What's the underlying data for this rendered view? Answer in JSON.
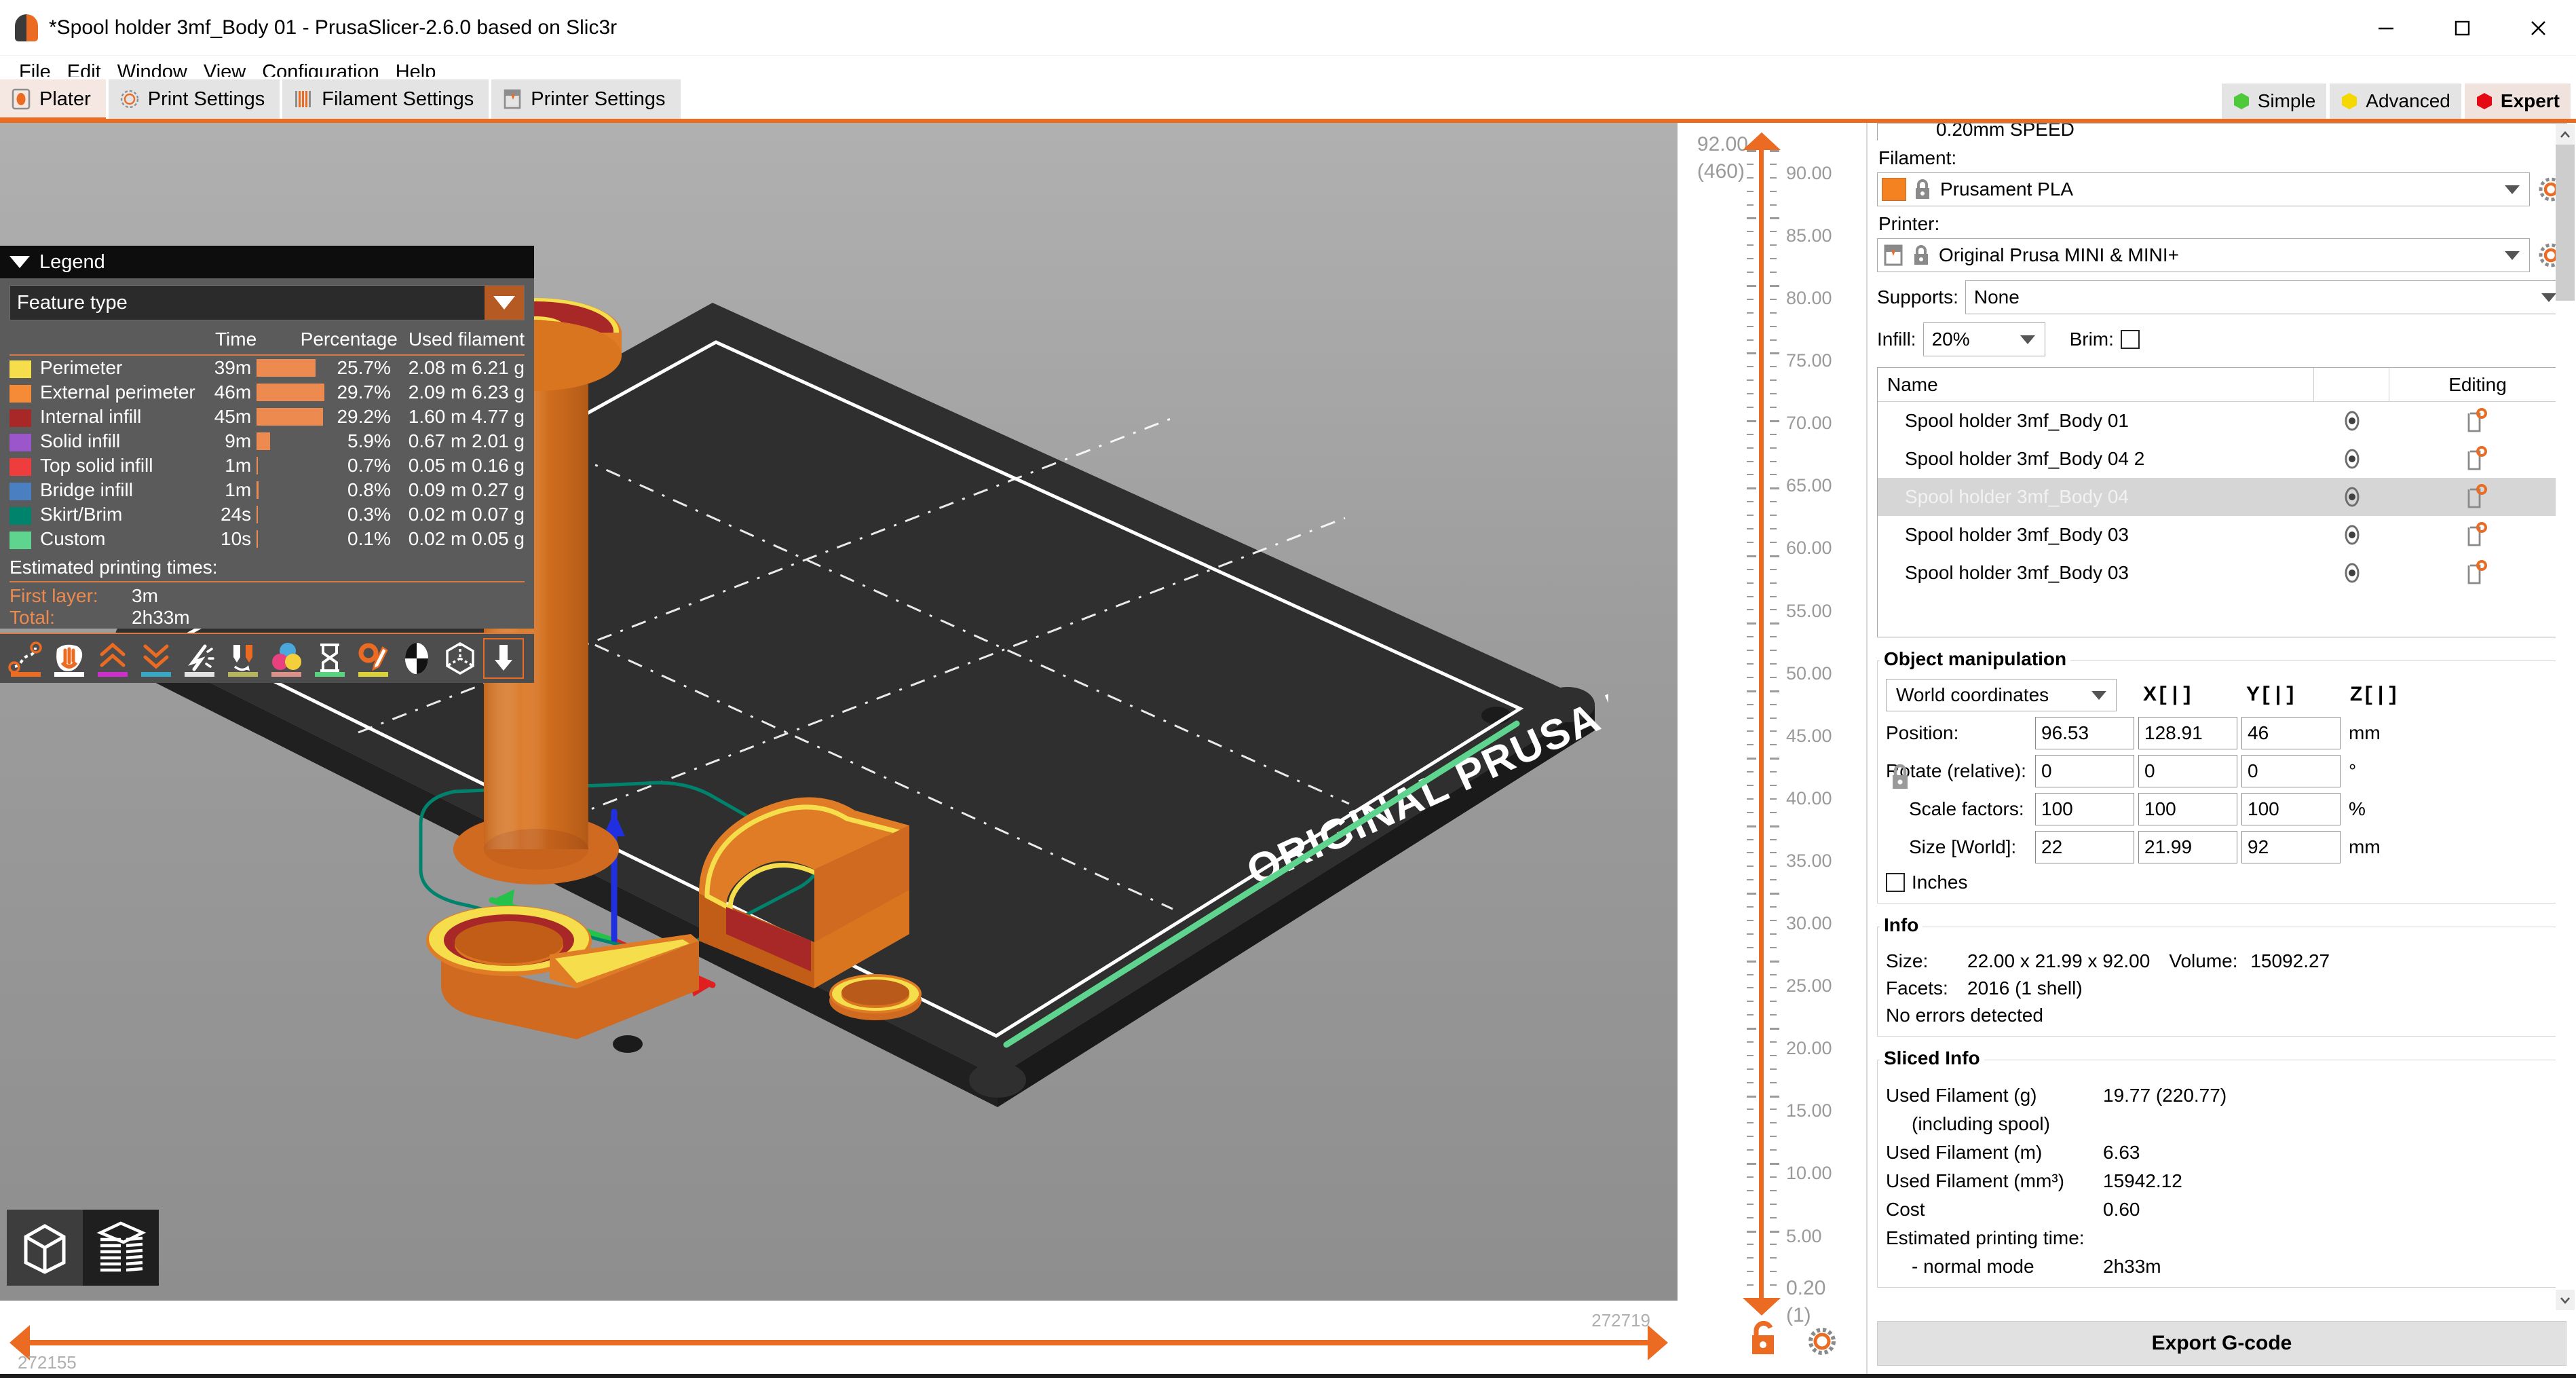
{
  "window": {
    "title": "*Spool holder 3mf_Body 01 - PrusaSlicer-2.6.0 based on Slic3r",
    "minimize": "minimize-icon",
    "maximize": "maximize-icon",
    "close": "close-icon"
  },
  "menu": {
    "items": [
      "File",
      "Edit",
      "Window",
      "View",
      "Configuration",
      "Help"
    ]
  },
  "tabs": [
    {
      "label": "Plater",
      "icon": "plater-icon",
      "active": true
    },
    {
      "label": "Print Settings",
      "icon": "print-settings-icon",
      "active": false
    },
    {
      "label": "Filament Settings",
      "icon": "filament-settings-icon",
      "active": false
    },
    {
      "label": "Printer Settings",
      "icon": "printer-settings-icon",
      "active": false
    }
  ],
  "modes": [
    {
      "label": "Simple",
      "color": "#4ec93a",
      "active": false
    },
    {
      "label": "Advanced",
      "color": "#f5d800",
      "active": false
    },
    {
      "label": "Expert",
      "color": "#e50914",
      "active": true
    }
  ],
  "legend": {
    "title": "Legend",
    "view_type": "Feature type",
    "columns": [
      "",
      "Time",
      "Percentage",
      "Used filament"
    ],
    "rows": [
      {
        "color": "#f5dd4b",
        "name": "Perimeter",
        "time": "39m",
        "pct": "25.7%",
        "pct_num": 25.7,
        "used": "2.08 m 6.21 g"
      },
      {
        "color": "#f68b37",
        "name": "External perimeter",
        "time": "46m",
        "pct": "29.7%",
        "pct_num": 29.7,
        "used": "2.09 m 6.23 g"
      },
      {
        "color": "#a82827",
        "name": "Internal infill",
        "time": "45m",
        "pct": "29.2%",
        "pct_num": 29.2,
        "used": "1.60 m 4.77 g"
      },
      {
        "color": "#9b56cc",
        "name": "Solid infill",
        "time": "9m",
        "pct": "5.9%",
        "pct_num": 5.9,
        "used": "0.67 m 2.01 g"
      },
      {
        "color": "#ee3d3d",
        "name": "Top solid infill",
        "time": "1m",
        "pct": "0.7%",
        "pct_num": 0.7,
        "used": "0.05 m 0.16 g"
      },
      {
        "color": "#4a7fc1",
        "name": "Bridge infill",
        "time": "1m",
        "pct": "0.8%",
        "pct_num": 0.8,
        "used": "0.09 m 0.27 g"
      },
      {
        "color": "#00836d",
        "name": "Skirt/Brim",
        "time": "24s",
        "pct": "0.3%",
        "pct_num": 0.3,
        "used": "0.02 m 0.07 g"
      },
      {
        "color": "#5fd48e",
        "name": "Custom",
        "time": "10s",
        "pct": "0.1%",
        "pct_num": 0.1,
        "used": "0.02 m 0.05 g"
      }
    ],
    "estimated_title": "Estimated printing times:",
    "first_layer_label": "First layer:",
    "first_layer_value": "3m",
    "total_label": "Total:",
    "total_value": "2h33m",
    "toolbar_icons": [
      {
        "name": "travel-paths-icon",
        "bar": "#ec6b23",
        "boxed": false
      },
      {
        "name": "wipe-icon",
        "bar": "#ffffff",
        "boxed": false
      },
      {
        "name": "retractions-icon",
        "bar": "#cc2fcc",
        "boxed": false
      },
      {
        "name": "deretractions-icon",
        "bar": "#34a8c4",
        "boxed": false
      },
      {
        "name": "seams-icon",
        "bar": "#e3e3e3",
        "boxed": false
      },
      {
        "name": "tool-changes-icon",
        "bar": "#b5b45a",
        "boxed": false
      },
      {
        "name": "color-changes-icon",
        "bar": "#d99189",
        "boxed": false
      },
      {
        "name": "pause-prints-icon",
        "bar": "#58d47e",
        "boxed": false
      },
      {
        "name": "custom-gcodes-icon",
        "bar": "#dbd23a",
        "boxed": false
      },
      {
        "name": "center-of-mass-icon",
        "bar": "",
        "boxed": false
      },
      {
        "name": "shells-icon",
        "bar": "",
        "boxed": false
      },
      {
        "name": "tool-marker-icon",
        "bar": "",
        "boxed": true
      }
    ]
  },
  "view_toggles": [
    {
      "name": "editor-view-icon",
      "label": "3D editor view"
    },
    {
      "name": "preview-view-icon",
      "label": "Preview"
    }
  ],
  "bed": {
    "brand_text": "ORIGINAL PRUSA MINI"
  },
  "horizontal_slider": {
    "right_value": "272719",
    "left_value": "272155"
  },
  "vertical_slider": {
    "top_value": "92.00",
    "top_layer": "(460)",
    "bottom_value": "0.20",
    "bottom_layer": "(1)",
    "ticks": [
      "90.00",
      "85.00",
      "80.00",
      "75.00",
      "70.00",
      "65.00",
      "60.00",
      "55.00",
      "50.00",
      "45.00",
      "40.00",
      "35.00",
      "30.00",
      "25.00",
      "20.00",
      "15.00",
      "10.00",
      "5.00"
    ],
    "lock_icon": "unlocked-icon",
    "gear_icon": "gear-icon"
  },
  "sidebar": {
    "print_preset_clipped": "0.20mm SPEED",
    "filament_label": "Filament:",
    "filament_value": "Prusament PLA",
    "filament_color": "#f58220",
    "printer_label": "Printer:",
    "printer_value": "Original Prusa MINI & MINI+",
    "supports_label": "Supports:",
    "supports_value": "None",
    "infill_label": "Infill:",
    "infill_value": "20%",
    "brim_label": "Brim:",
    "brim_checked": false,
    "objlist": {
      "col_name": "Name",
      "col_editing": "Editing",
      "rows": [
        {
          "name": "Spool holder 3mf_Body 01",
          "selected": false
        },
        {
          "name": "Spool holder 3mf_Body 04 2",
          "selected": false
        },
        {
          "name": "Spool holder 3mf_Body 04",
          "selected": true
        },
        {
          "name": "Spool holder 3mf_Body 03",
          "selected": false
        },
        {
          "name": "Spool holder 3mf_Body 03",
          "selected": false
        }
      ]
    },
    "manipulation": {
      "title": "Object manipulation",
      "coordinates": "World coordinates",
      "axes": [
        "X",
        "Y",
        "Z"
      ],
      "rows": [
        {
          "label": "Position:",
          "x": "96.53",
          "y": "128.91",
          "z": "46",
          "unit": "mm",
          "indent": false
        },
        {
          "label": "Rotate (relative):",
          "x": "0",
          "y": "0",
          "z": "0",
          "unit": "°",
          "indent": false
        },
        {
          "label": "Scale factors:",
          "x": "100",
          "y": "100",
          "z": "100",
          "unit": "%",
          "indent": true
        },
        {
          "label": "Size [World]:",
          "x": "22",
          "y": "21.99",
          "z": "92",
          "unit": "mm",
          "indent": true
        }
      ],
      "inches_label": "Inches",
      "inches_checked": false,
      "lock_icon": "uniform-scale-lock-icon"
    },
    "info": {
      "title": "Info",
      "size_key": "Size:",
      "size_value": "22.00 x 21.99 x 92.00",
      "volume_key": "Volume:",
      "volume_value": "15092.27",
      "facets_key": "Facets:",
      "facets_value": "2016 (1 shell)",
      "errors": "No errors detected"
    },
    "sliced_info": {
      "title": "Sliced Info",
      "rows": [
        {
          "key": "Used Filament (g)",
          "value": "19.77 (220.77)",
          "sub": false
        },
        {
          "key": "(including spool)",
          "value": "",
          "sub": true
        },
        {
          "key": "Used Filament (m)",
          "value": "6.63",
          "sub": false
        },
        {
          "key": "Used Filament (mm³)",
          "value": "15942.12",
          "sub": false
        },
        {
          "key": "Cost",
          "value": "0.60",
          "sub": false
        },
        {
          "key": "Estimated printing time:",
          "value": "",
          "sub": false
        },
        {
          "key": "- normal mode",
          "value": "2h33m",
          "sub": true
        }
      ]
    },
    "export_button": "Export G-code"
  }
}
